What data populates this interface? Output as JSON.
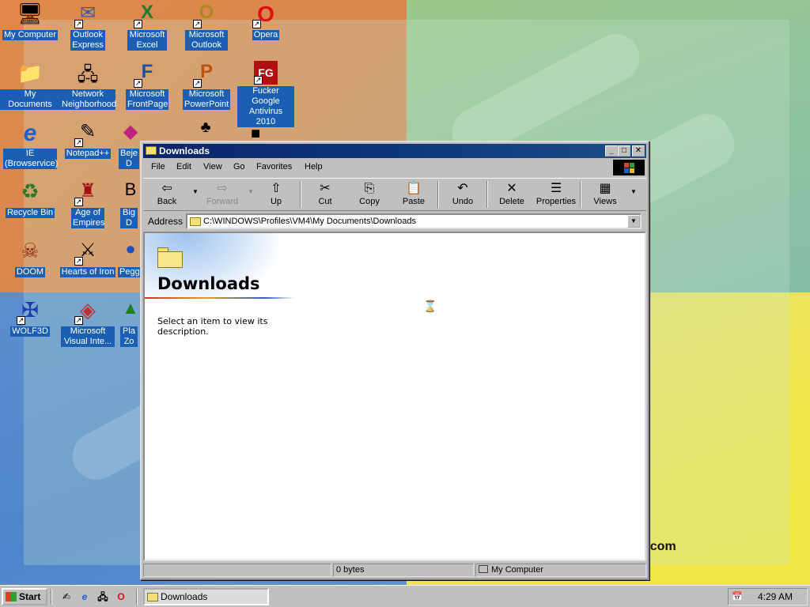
{
  "wallpaper": {
    "text": "t.com"
  },
  "desktop_icons": [
    {
      "label": "My Computer",
      "glyph": "🖥"
    },
    {
      "label": "Outlook Express",
      "glyph": "✉"
    },
    {
      "label": "Microsoft Excel",
      "glyph": "X"
    },
    {
      "label": "Microsoft Outlook",
      "glyph": "O"
    },
    {
      "label": "Opera",
      "glyph": "O"
    },
    {
      "label": "My Documents",
      "glyph": "📁"
    },
    {
      "label": "Network Neighborhood",
      "glyph": "🖧"
    },
    {
      "label": "Microsoft FrontPage",
      "glyph": "F"
    },
    {
      "label": "Microsoft PowerPoint",
      "glyph": "P"
    },
    {
      "label": "Fucker Google Antivirus 2010",
      "glyph": "FG"
    },
    {
      "label": "IE (Browservice)",
      "glyph": "e"
    },
    {
      "label": "Notepad++",
      "glyph": "✎"
    },
    {
      "label": "Beje D",
      "glyph": "◆"
    },
    {
      "label": "",
      "glyph": "♣"
    },
    {
      "label": "",
      "glyph": "■"
    },
    {
      "label": "Recycle Bin",
      "glyph": "♻"
    },
    {
      "label": "Age of Empires",
      "glyph": "♜"
    },
    {
      "label": "Big D",
      "glyph": "B"
    },
    {
      "label": "DOOM",
      "glyph": "☠"
    },
    {
      "label": "Hearts of Iron",
      "glyph": "⚔"
    },
    {
      "label": "Pegg",
      "glyph": "●"
    },
    {
      "label": "WOLF3D",
      "glyph": "✠"
    },
    {
      "label": "Microsoft Visual Inte...",
      "glyph": "◈"
    },
    {
      "label": "Pla Zo",
      "glyph": "▲"
    }
  ],
  "window": {
    "title": "Downloads",
    "controls": {
      "minimize": "_",
      "maximize": "□",
      "close": "✕"
    },
    "menu": [
      "File",
      "Edit",
      "View",
      "Go",
      "Favorites",
      "Help"
    ],
    "toolbar": [
      {
        "label": "Back",
        "glyph": "⇦",
        "enabled": true
      },
      {
        "label": "Forward",
        "glyph": "⇨",
        "enabled": false
      },
      {
        "label": "Up",
        "glyph": "⇧",
        "enabled": true
      },
      {
        "label": "Cut",
        "glyph": "✂",
        "enabled": true
      },
      {
        "label": "Copy",
        "glyph": "⎘",
        "enabled": true
      },
      {
        "label": "Paste",
        "glyph": "📋",
        "enabled": true
      },
      {
        "label": "Undo",
        "glyph": "↶",
        "enabled": true
      },
      {
        "label": "Delete",
        "glyph": "✕",
        "enabled": true
      },
      {
        "label": "Properties",
        "glyph": "☰",
        "enabled": true
      },
      {
        "label": "Views",
        "glyph": "▦",
        "enabled": true
      }
    ],
    "address": {
      "label": "Address",
      "value": "C:\\WINDOWS\\Profiles\\VM4\\My Documents\\Downloads"
    },
    "content": {
      "folder_title": "Downloads",
      "description": "Select an item to view its description."
    },
    "status": {
      "size": "0 bytes",
      "zone": "My Computer"
    }
  },
  "taskbar": {
    "start_label": "Start",
    "quick_launch": [
      "✍",
      "e",
      "🖧",
      "O"
    ],
    "task_label": "Downloads",
    "clock": "4:29 AM"
  }
}
